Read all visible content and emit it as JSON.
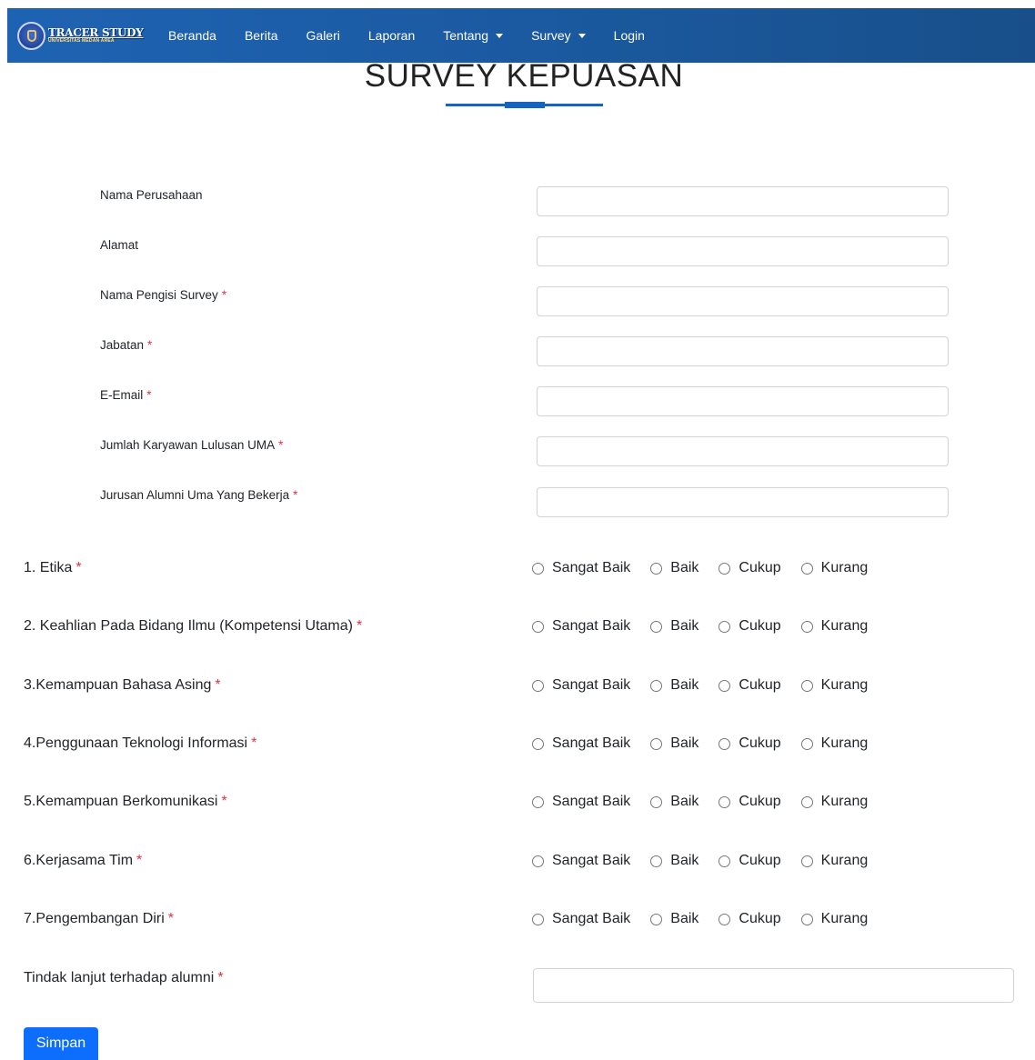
{
  "brand": {
    "title": "TRACER STUDY",
    "subtitle": "UNIVERSITAS MEDAN AREA"
  },
  "nav": {
    "items": [
      {
        "label": "Beranda",
        "dropdown": false
      },
      {
        "label": "Berita",
        "dropdown": false
      },
      {
        "label": "Galeri",
        "dropdown": false
      },
      {
        "label": "Laporan",
        "dropdown": false
      },
      {
        "label": "Tentang",
        "dropdown": true
      },
      {
        "label": "Survey",
        "dropdown": true
      },
      {
        "label": "Login",
        "dropdown": false
      }
    ]
  },
  "page": {
    "title": "SURVEY KEPUASAN"
  },
  "form": {
    "fields": [
      {
        "label": "Nama Perusahaan",
        "required": false,
        "value": ""
      },
      {
        "label": "Alamat",
        "required": false,
        "value": ""
      },
      {
        "label": "Nama Pengisi Survey",
        "required": true,
        "value": ""
      },
      {
        "label": "Jabatan",
        "required": true,
        "value": ""
      },
      {
        "label": "E-Email",
        "required": true,
        "value": ""
      },
      {
        "label": "Jumlah Karyawan Lulusan UMA",
        "required": true,
        "value": ""
      },
      {
        "label": "Jurusan Alumni Uma Yang Bekerja",
        "required": true,
        "value": ""
      }
    ],
    "questions": [
      {
        "label": "1. Etika",
        "required": true
      },
      {
        "label": "2. Keahlian Pada Bidang Ilmu (Kompetensi Utama)",
        "required": true
      },
      {
        "label": "3.Kemampuan Bahasa Asing",
        "required": true
      },
      {
        "label": "4.Penggunaan Teknologi Informasi",
        "required": true
      },
      {
        "label": "5.Kemampuan Berkomunikasi",
        "required": true
      },
      {
        "label": "6.Kerjasama Tim",
        "required": true
      },
      {
        "label": "7.Pengembangan Diri",
        "required": true
      }
    ],
    "options": [
      "Sangat Baik",
      "Baik",
      "Cukup",
      "Kurang"
    ],
    "followup": {
      "label": "Tindak lanjut terhadap alumni",
      "required": true,
      "value": ""
    },
    "required_mark": "*",
    "submit_label": "Simpan"
  },
  "colors": {
    "navbar": "#1b5aa1",
    "accent": "#1565c0",
    "button": "#0d6efd",
    "required": "#dc3545"
  }
}
